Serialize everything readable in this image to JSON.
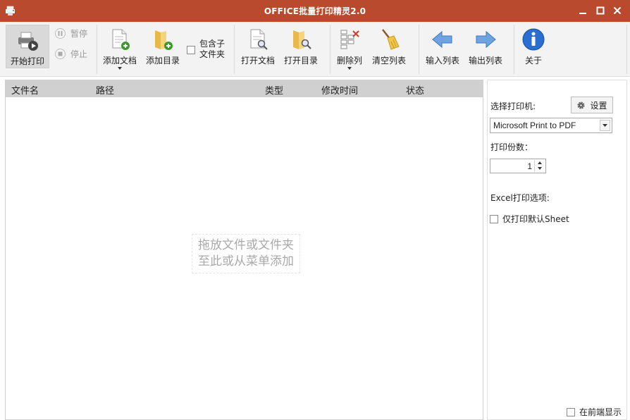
{
  "window": {
    "title": "OFFICE批量打印精灵2.0"
  },
  "toolbar": {
    "start_print": "开始打印",
    "pause": "暂停",
    "stop": "停止",
    "add_doc": "添加文档",
    "add_dir": "添加目录",
    "include_sub_line1": "包含子",
    "include_sub_line2": "文件夹",
    "open_doc": "打开文档",
    "open_dir": "打开目录",
    "delete_col": "删除列",
    "clear_list": "清空列表",
    "import_list": "输入列表",
    "export_list": "输出列表",
    "about": "关于"
  },
  "list": {
    "columns": [
      "文件名",
      "路径",
      "类型",
      "修改时间",
      "状态"
    ],
    "empty_hint_line1": "拖放文件或文件夹",
    "empty_hint_line2": "至此或从菜单添加"
  },
  "side": {
    "select_printer_label": "选择打印机:",
    "settings_button": "设置",
    "printer_value": "Microsoft Print to PDF",
    "copies_label": "打印份数：",
    "copies_value": "1",
    "excel_options_label": "Excel打印选项:",
    "only_default_sheet": "仅打印默认Sheet",
    "always_on_top": "在前端显示"
  },
  "colors": {
    "titlebar": "#b94a2d",
    "header_bg": "#d0d0d0",
    "toolbar_bg": "#f3f3f3"
  }
}
